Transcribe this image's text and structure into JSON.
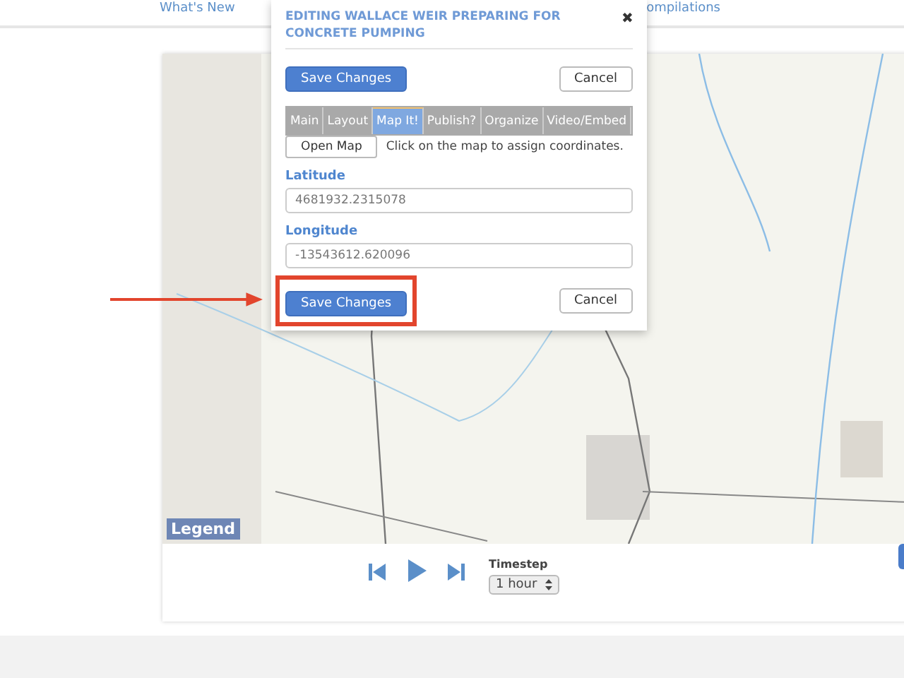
{
  "nav": {
    "items": [
      {
        "label": "What's New"
      },
      {
        "label": "ompilations"
      }
    ]
  },
  "dialog": {
    "title": "EDITING WALLACE WEIR PREPARING FOR CONCRETE PUMPING",
    "close": "✖",
    "save": "Save Changes",
    "cancel": "Cancel",
    "tabs": [
      {
        "label": "Main",
        "selected": false
      },
      {
        "label": "Layout",
        "selected": false
      },
      {
        "label": "Map It!",
        "selected": true
      },
      {
        "label": "Publish?",
        "selected": false
      },
      {
        "label": "Organize",
        "selected": false
      },
      {
        "label": "Video/Embed",
        "selected": false
      }
    ],
    "open_map": "Open Map",
    "hint": "Click on the map to assign coordinates.",
    "fields": [
      {
        "label": "Latitude",
        "value": "4681932.2315078"
      },
      {
        "label": "Longitude",
        "value": "-13543612.620096"
      }
    ],
    "bottom_save": "Save Changes",
    "bottom_cancel": "Cancel"
  },
  "map": {
    "legend": "Legend"
  },
  "player": {
    "timestep_label": "Timestep",
    "timestep": "1 hour"
  }
}
